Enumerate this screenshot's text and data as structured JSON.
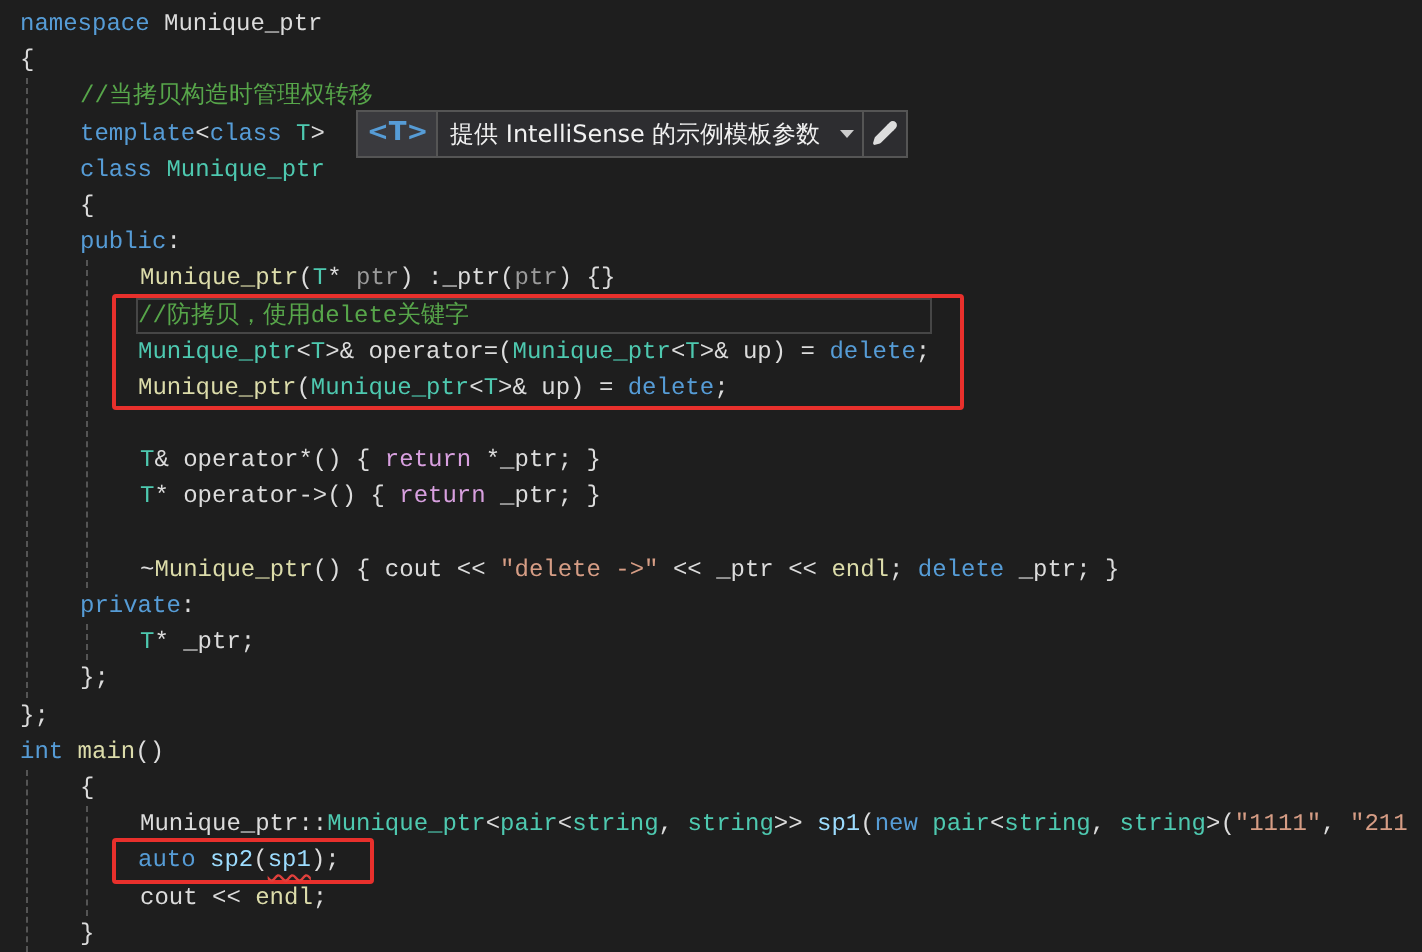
{
  "editor": {
    "lines": [
      {
        "kind": "code",
        "current": false,
        "tokens": [
          {
            "text": "namespace",
            "kind": "kw"
          },
          {
            "text": " Munique_ptr",
            "kind": "pl"
          }
        ]
      },
      {
        "kind": "code",
        "current": false,
        "tokens": [
          {
            "text": "{",
            "kind": "pl"
          }
        ],
        "children": [
          {
            "kind": "code",
            "current": false,
            "tokens": [
              {
                "text": "//当拷贝构造时管理权转移",
                "kind": "cm"
              }
            ]
          },
          {
            "kind": "code",
            "current": false,
            "tokens": [
              {
                "text": "template",
                "kind": "kw"
              },
              {
                "text": "<",
                "kind": "pl"
              },
              {
                "text": "class",
                "kind": "kw"
              },
              {
                "text": " T",
                "kind": "type"
              },
              {
                "text": ">",
                "kind": "pl"
              }
            ],
            "hint": {
              "badge": "<T>",
              "text": "提供 IntelliSense 的示例模板参数"
            }
          },
          {
            "kind": "code",
            "current": false,
            "tokens": [
              {
                "text": "class",
                "kind": "kw"
              },
              {
                "text": " Munique_ptr",
                "kind": "type"
              }
            ]
          },
          {
            "kind": "code",
            "current": false,
            "tokens": [
              {
                "text": "{",
                "kind": "pl"
              }
            ]
          },
          {
            "kind": "code",
            "current": false,
            "tokens": [
              {
                "text": "public",
                "kind": "kw"
              },
              {
                "text": ":",
                "kind": "pl"
              }
            ],
            "children": [
              {
                "kind": "code",
                "current": false,
                "tokens": [
                  {
                    "text": "Munique_ptr",
                    "kind": "fn"
                  },
                  {
                    "text": "(",
                    "kind": "pl"
                  },
                  {
                    "text": "T",
                    "kind": "type"
                  },
                  {
                    "text": "* ",
                    "kind": "pl"
                  },
                  {
                    "text": "ptr",
                    "kind": "param"
                  },
                  {
                    "text": ") :_ptr(",
                    "kind": "pl"
                  },
                  {
                    "text": "ptr",
                    "kind": "param"
                  },
                  {
                    "text": ") {}",
                    "kind": "pl"
                  }
                ]
              },
              {
                "kind": "box",
                "lines": [
                  {
                    "kind": "code",
                    "current": true,
                    "tokens": [
                      {
                        "text": "//防拷贝，使用delete关键字",
                        "kind": "cm"
                      }
                    ]
                  },
                  {
                    "kind": "code",
                    "current": false,
                    "tokens": [
                      {
                        "text": "Munique_ptr",
                        "kind": "type"
                      },
                      {
                        "text": "<",
                        "kind": "pl"
                      },
                      {
                        "text": "T",
                        "kind": "type"
                      },
                      {
                        "text": ">& operator=(",
                        "kind": "pl"
                      },
                      {
                        "text": "Munique_ptr",
                        "kind": "type"
                      },
                      {
                        "text": "<",
                        "kind": "pl"
                      },
                      {
                        "text": "T",
                        "kind": "type"
                      },
                      {
                        "text": ">& up) = ",
                        "kind": "pl"
                      },
                      {
                        "text": "delete",
                        "kind": "kw"
                      },
                      {
                        "text": ";",
                        "kind": "pl"
                      }
                    ]
                  },
                  {
                    "kind": "code",
                    "current": false,
                    "tokens": [
                      {
                        "text": "Munique_ptr",
                        "kind": "fn"
                      },
                      {
                        "text": "(",
                        "kind": "pl"
                      },
                      {
                        "text": "Munique_ptr",
                        "kind": "type"
                      },
                      {
                        "text": "<",
                        "kind": "pl"
                      },
                      {
                        "text": "T",
                        "kind": "type"
                      },
                      {
                        "text": ">& up) = ",
                        "kind": "pl"
                      },
                      {
                        "text": "delete",
                        "kind": "kw"
                      },
                      {
                        "text": ";",
                        "kind": "pl"
                      }
                    ]
                  }
                ]
              },
              {
                "kind": "blank"
              },
              {
                "kind": "code",
                "current": false,
                "tokens": [
                  {
                    "text": "T",
                    "kind": "type"
                  },
                  {
                    "text": "& operator*() { ",
                    "kind": "pl"
                  },
                  {
                    "text": "return",
                    "kind": "ctl"
                  },
                  {
                    "text": " *_ptr; }",
                    "kind": "pl"
                  }
                ]
              },
              {
                "kind": "code",
                "current": false,
                "tokens": [
                  {
                    "text": "T",
                    "kind": "type"
                  },
                  {
                    "text": "* operator->() { ",
                    "kind": "pl"
                  },
                  {
                    "text": "return",
                    "kind": "ctl"
                  },
                  {
                    "text": " _ptr; }",
                    "kind": "pl"
                  }
                ]
              },
              {
                "kind": "blank"
              },
              {
                "kind": "code",
                "current": false,
                "tokens": [
                  {
                    "text": "~",
                    "kind": "pl"
                  },
                  {
                    "text": "Munique_ptr",
                    "kind": "fn"
                  },
                  {
                    "text": "() { cout << ",
                    "kind": "pl"
                  },
                  {
                    "text": "\"delete ->\"",
                    "kind": "str"
                  },
                  {
                    "text": " << _ptr << ",
                    "kind": "pl"
                  },
                  {
                    "text": "endl",
                    "kind": "fn"
                  },
                  {
                    "text": "; ",
                    "kind": "pl"
                  },
                  {
                    "text": "delete",
                    "kind": "kw"
                  },
                  {
                    "text": " _ptr; }",
                    "kind": "pl"
                  }
                ]
              }
            ]
          },
          {
            "kind": "code",
            "current": false,
            "tokens": [
              {
                "text": "private",
                "kind": "kw"
              },
              {
                "text": ":",
                "kind": "pl"
              }
            ],
            "children": [
              {
                "kind": "code",
                "current": false,
                "tokens": [
                  {
                    "text": "T",
                    "kind": "type"
                  },
                  {
                    "text": "* _ptr;",
                    "kind": "pl"
                  }
                ]
              }
            ]
          },
          {
            "kind": "code",
            "current": false,
            "tokens": [
              {
                "text": "};",
                "kind": "pl"
              }
            ]
          }
        ]
      },
      {
        "kind": "code",
        "current": false,
        "tokens": [
          {
            "text": "};",
            "kind": "pl"
          }
        ]
      },
      {
        "kind": "code",
        "current": false,
        "tokens": [
          {
            "text": "int",
            "kind": "kw"
          },
          {
            "text": " main",
            "kind": "fn"
          },
          {
            "text": "()",
            "kind": "pl"
          }
        ],
        "children": [
          {
            "kind": "code",
            "current": false,
            "tokens": [
              {
                "text": "{",
                "kind": "pl"
              }
            ],
            "children": [
              {
                "kind": "code",
                "current": false,
                "tokens": [
                  {
                    "text": "Munique_ptr::",
                    "kind": "pl"
                  },
                  {
                    "text": "Munique_ptr",
                    "kind": "type"
                  },
                  {
                    "text": "<",
                    "kind": "pl"
                  },
                  {
                    "text": "pair",
                    "kind": "type"
                  },
                  {
                    "text": "<",
                    "kind": "pl"
                  },
                  {
                    "text": "string",
                    "kind": "type"
                  },
                  {
                    "text": ", ",
                    "kind": "pl"
                  },
                  {
                    "text": "string",
                    "kind": "type"
                  },
                  {
                    "text": ">> ",
                    "kind": "pl"
                  },
                  {
                    "text": "sp1",
                    "kind": "var"
                  },
                  {
                    "text": "(",
                    "kind": "pl"
                  },
                  {
                    "text": "new",
                    "kind": "kw"
                  },
                  {
                    "text": " pair",
                    "kind": "type"
                  },
                  {
                    "text": "<",
                    "kind": "pl"
                  },
                  {
                    "text": "string",
                    "kind": "type"
                  },
                  {
                    "text": ", ",
                    "kind": "pl"
                  },
                  {
                    "text": "string",
                    "kind": "type"
                  },
                  {
                    "text": ">(",
                    "kind": "pl"
                  },
                  {
                    "text": "\"1111\"",
                    "kind": "str"
                  },
                  {
                    "text": ", ",
                    "kind": "pl"
                  },
                  {
                    "text": "\"211",
                    "kind": "str"
                  }
                ]
              },
              {
                "kind": "box",
                "lines": [
                  {
                    "kind": "code",
                    "current": false,
                    "tokens": [
                      {
                        "text": "auto",
                        "kind": "kw",
                        "error": false
                      },
                      {
                        "text": " sp2",
                        "kind": "var",
                        "error": false
                      },
                      {
                        "text": "(",
                        "kind": "pl",
                        "error": false
                      },
                      {
                        "text": "sp1",
                        "kind": "var",
                        "error": true
                      },
                      {
                        "text": ");",
                        "kind": "pl",
                        "error": false
                      }
                    ]
                  }
                ]
              },
              {
                "kind": "code",
                "current": false,
                "tokens": [
                  {
                    "text": "cout << ",
                    "kind": "pl"
                  },
                  {
                    "text": "endl",
                    "kind": "fn"
                  },
                  {
                    "text": ";",
                    "kind": "pl"
                  }
                ]
              }
            ]
          },
          {
            "kind": "code",
            "current": false,
            "tokens": [
              {
                "text": "}",
                "kind": "pl"
              }
            ]
          }
        ]
      }
    ]
  }
}
